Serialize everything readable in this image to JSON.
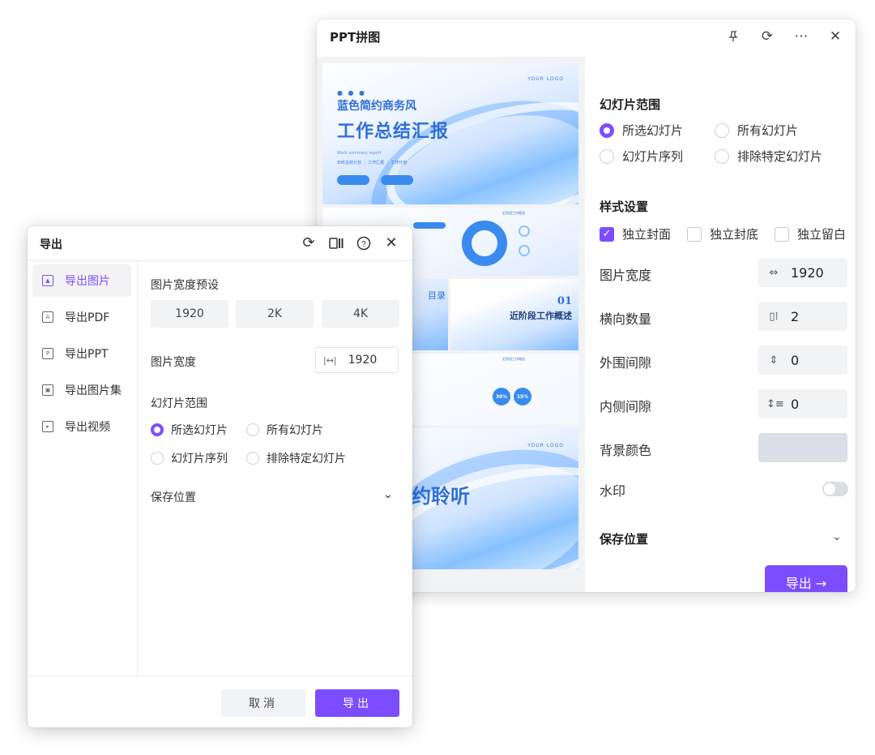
{
  "ppt_window": {
    "title": "PPT拼图",
    "icons": [
      "pin-icon",
      "refresh-icon",
      "more-icon",
      "close-icon"
    ],
    "slides": {
      "cover": {
        "brand": "YOUR LOGO",
        "subtitle": "蓝色简约商务风",
        "title": "工作总结汇报",
        "en": "Work summary report",
        "tags": "年终总结计划 ｜ 工作汇报 ｜ 工作计划"
      },
      "overview_title": "近阶段工作概述",
      "toc": "目录",
      "part_num": "01",
      "part_title": "近阶段工作概述",
      "stat1": "30%",
      "stat2": "15%",
      "ending_brand": "YOUR LOGO",
      "ending_text": "约聆听"
    },
    "slide_range": {
      "title": "幻灯片范围",
      "options": [
        "所选幻灯片",
        "所有幻灯片",
        "幻灯片序列",
        "排除特定幻灯片"
      ],
      "selected": 0
    },
    "style": {
      "title": "样式设置",
      "checks": [
        {
          "label": "独立封面",
          "checked": true
        },
        {
          "label": "独立封底",
          "checked": false
        },
        {
          "label": "独立留白",
          "checked": false
        }
      ]
    },
    "fields": {
      "width_label": "图片宽度",
      "width_value": "1920",
      "count_label": "横向数量",
      "count_value": "2",
      "outer_label": "外围间隙",
      "outer_value": "0",
      "inner_label": "内侧间隙",
      "inner_value": "0",
      "bg_label": "背景颜色",
      "bg_color": "#dcdfe8",
      "watermark_label": "水印",
      "watermark_on": false
    },
    "save_location": "保存位置",
    "export_button": "导出 →"
  },
  "export_dialog": {
    "title": "导出",
    "icons": [
      "refresh-icon",
      "columns-icon",
      "help-icon",
      "close-icon"
    ],
    "nav": [
      {
        "label": "导出图片",
        "icon": "image-icon",
        "active": true
      },
      {
        "label": "导出PDF",
        "icon": "pdf-icon",
        "active": false
      },
      {
        "label": "导出PPT",
        "icon": "ppt-icon",
        "active": false
      },
      {
        "label": "导出图片集",
        "icon": "gallery-icon",
        "active": false
      },
      {
        "label": "导出视频",
        "icon": "video-icon",
        "active": false
      }
    ],
    "preset_label": "图片宽度预设",
    "presets": [
      "1920",
      "2K",
      "4K"
    ],
    "width_label": "图片宽度",
    "width_value": "1920",
    "range_label": "幻灯片范围",
    "range_options": [
      "所选幻灯片",
      "所有幻灯片",
      "幻灯片序列",
      "排除特定幻灯片"
    ],
    "range_selected": 0,
    "save_label": "保存位置",
    "cancel": "取消",
    "ok": "导出"
  },
  "colors": {
    "accent": "#7c4dff",
    "field_bg": "#f2f3f5"
  }
}
